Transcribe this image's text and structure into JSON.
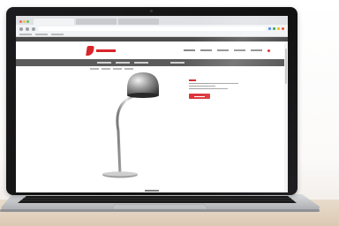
{
  "scene": {
    "colors": {
      "brand_red": "#d9242a",
      "laptop_body": "#1c1c1e",
      "aluminium": "#c9cbce",
      "table_wood": "#e2d2bf",
      "dark_bar": "#5b5b5b"
    }
  },
  "browser": {
    "window_controls": [
      "close-icon",
      "minimize-icon",
      "maximize-icon"
    ],
    "tabs": [
      {
        "state": "active"
      },
      {
        "state": "inactive"
      },
      {
        "state": "inactive"
      }
    ],
    "toolbar_icons": [
      "back-icon",
      "forward-icon",
      "reload-icon"
    ],
    "extension_icons": [
      "extension-icon",
      "extension-icon",
      "extension-icon",
      "profile-icon"
    ],
    "extension_colors": [
      "#4285f4",
      "#34a853",
      "#fbbc05",
      "#ea4335"
    ]
  },
  "website": {
    "logo_icon": "brand-logo-icon",
    "cart_icon": "cart-icon",
    "product": {
      "image_icon": "desk-lamp-image",
      "has_add_to_cart_button": true
    }
  },
  "laptop": {
    "keyboard_icon": "keyboard-icon",
    "trackpad_icon": "trackpad-icon"
  }
}
